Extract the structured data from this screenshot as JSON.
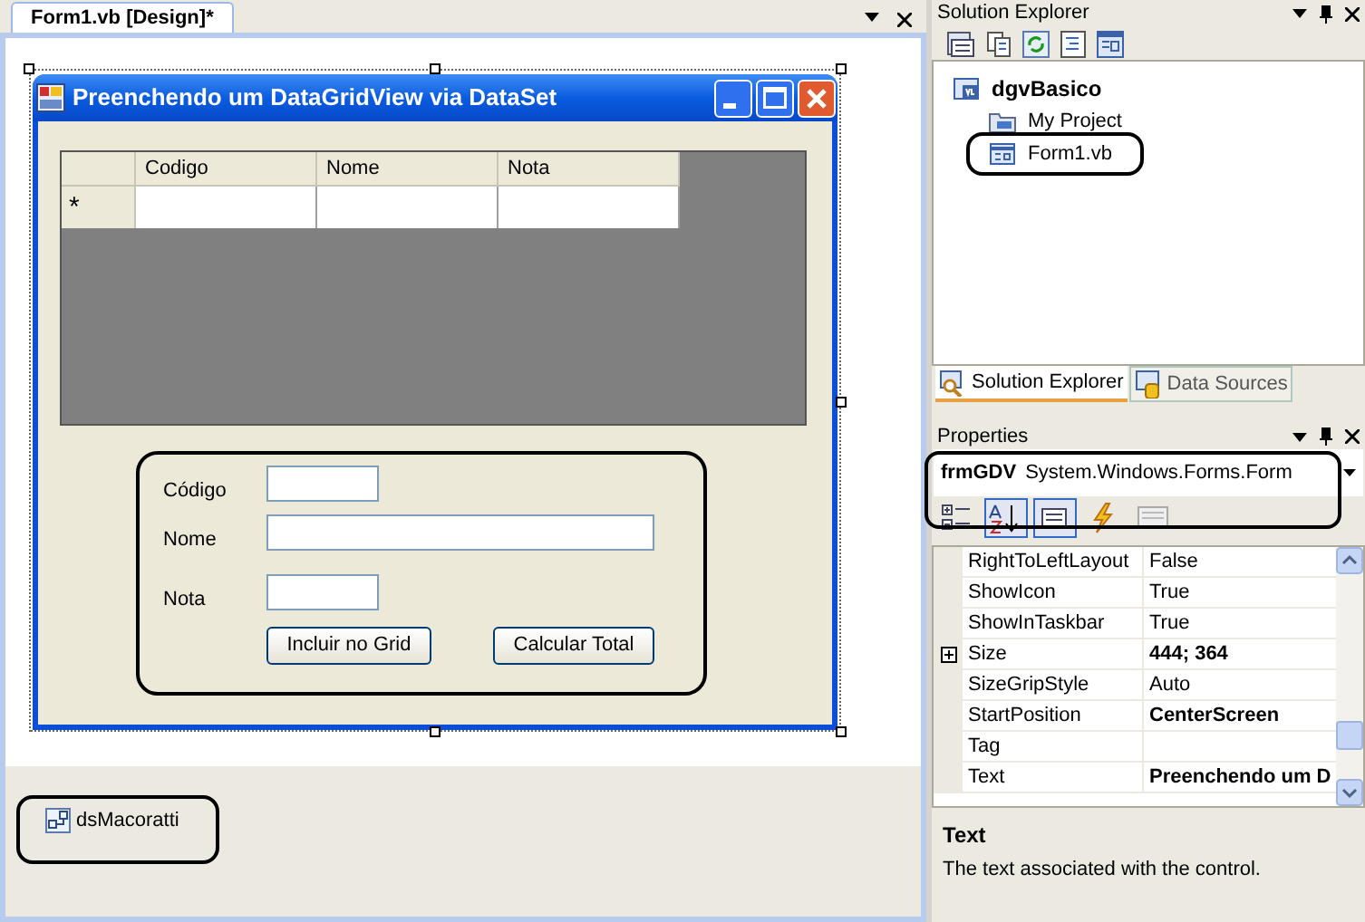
{
  "document_tab": {
    "title": "Form1.vb [Design]*",
    "selected": true
  },
  "form": {
    "title": "Preenchendo um DataGridView via DataSet",
    "grid": {
      "columns": [
        "Codigo",
        "Nome",
        "Nota"
      ],
      "new_row_marker": "*"
    },
    "group_highlighted": true,
    "fields": [
      {
        "label": "Código",
        "kind": "short"
      },
      {
        "label": "Nome",
        "kind": "long"
      },
      {
        "label": "Nota",
        "kind": "short"
      }
    ],
    "buttons": [
      "Incluir no Grid",
      "Calcular Total"
    ]
  },
  "tray": [
    {
      "name": "dsMacoratti",
      "highlighted": true
    }
  ],
  "solution_explorer": {
    "title": "Solution Explorer",
    "tree": [
      {
        "label": "dgvBasico",
        "highlighted": false,
        "children": [
          {
            "label": "My Project",
            "kind": "folder",
            "highlighted": false
          },
          {
            "label": "Form1.vb",
            "kind": "form",
            "highlighted": true
          }
        ]
      }
    ],
    "tabs": [
      {
        "label": "Solution Explorer",
        "selected": true
      },
      {
        "label": "Data Sources",
        "selected": false
      }
    ]
  },
  "properties": {
    "title": "Properties",
    "object": {
      "name": "frmGDV",
      "type": "System.Windows.Forms.Form",
      "highlighted": true
    },
    "toolbar": [
      {
        "kind": "categorized",
        "selected": false
      },
      {
        "kind": "alphabetical",
        "selected": true
      },
      {
        "kind": "properties",
        "selected": true
      },
      {
        "kind": "events",
        "selected": false
      },
      {
        "kind": "pages",
        "selected": false
      }
    ],
    "rows": [
      {
        "name": "RightToLeftLayout",
        "value": "False",
        "modified": false,
        "expandable": false
      },
      {
        "name": "ShowIcon",
        "value": "True",
        "modified": false,
        "expandable": false
      },
      {
        "name": "ShowInTaskbar",
        "value": "True",
        "modified": false,
        "expandable": false
      },
      {
        "name": "Size",
        "value": "444; 364",
        "modified": true,
        "expandable": true
      },
      {
        "name": "SizeGripStyle",
        "value": "Auto",
        "modified": false,
        "expandable": false
      },
      {
        "name": "StartPosition",
        "value": "CenterScreen",
        "modified": true,
        "expandable": false
      },
      {
        "name": "Tag",
        "expandable": false
      },
      {
        "name": "Text",
        "value": "Preenchendo um D",
        "modified": true,
        "expandable": false
      }
    ],
    "description": {
      "title": "Text",
      "body": "The text associated with the control."
    }
  }
}
